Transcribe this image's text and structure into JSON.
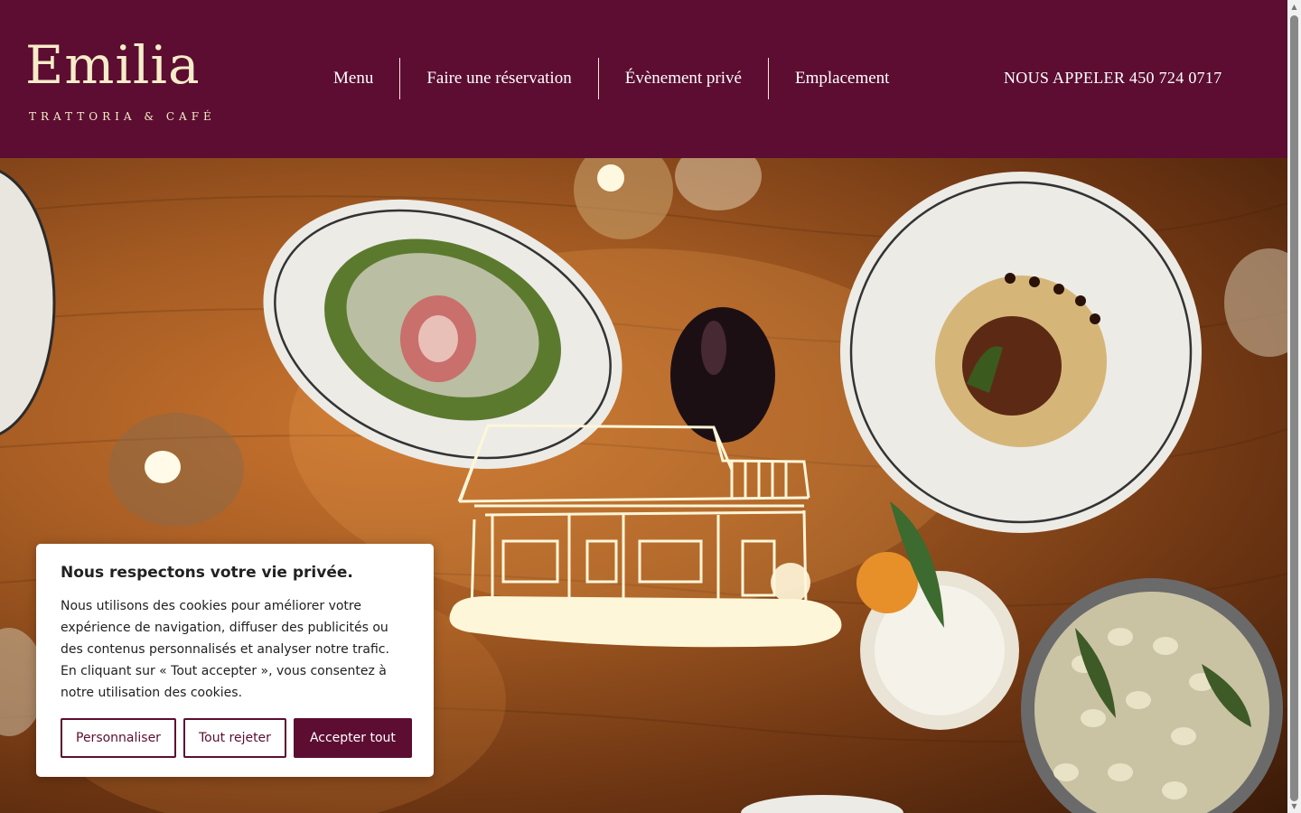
{
  "header": {
    "logo_word": "Emilia",
    "logo_sub": "TRATTORIA & CAFÉ",
    "nav": [
      {
        "label": "Menu"
      },
      {
        "label": "Faire une réservation"
      },
      {
        "label": "Évènement privé"
      },
      {
        "label": "Emplacement"
      }
    ],
    "phone": "NOUS APPELER 450 724 0717"
  },
  "cookie": {
    "title": "Nous respectons votre vie privée.",
    "text": "Nous utilisons des cookies pour améliorer votre expérience de navigation, diffuser des publicités ou des contenus personnalisés et analyser notre trafic. En cliquant sur « Tout accepter », vous consentez à notre utilisation des cookies.",
    "customize": "Personnaliser",
    "reject": "Tout rejeter",
    "accept": "Accepter tout"
  },
  "colors": {
    "brand": "#5c0d31",
    "cream": "#f6ecc9"
  }
}
